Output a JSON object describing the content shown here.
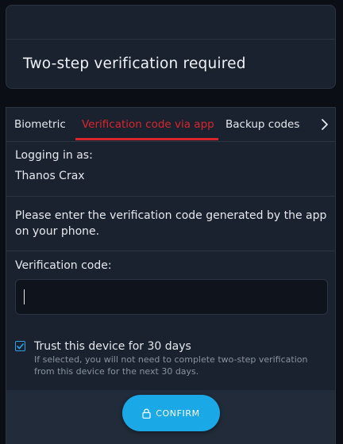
{
  "header": {
    "title": "Two-step verification required"
  },
  "tabs": [
    {
      "label": "Biometric",
      "active": false
    },
    {
      "label": "Verification code via app",
      "active": true
    },
    {
      "label": "Backup codes",
      "active": false
    }
  ],
  "tabs_more_icon": "chevron-right-icon",
  "login": {
    "label": "Logging in as:",
    "user": "Thanos Crax"
  },
  "instructions": "Please enter the verification code generated by the app on your phone.",
  "code_field": {
    "label": "Verification code:",
    "value": "",
    "placeholder": ""
  },
  "trust": {
    "checked": true,
    "label": "Trust this device for 30 days",
    "help": "If selected, you will not need to complete two-step verification from this device for the next 30 days."
  },
  "confirm": {
    "label": "CONFIRM",
    "icon": "lock-icon"
  },
  "colors": {
    "accent_red": "#d9262c",
    "accent_blue": "#1ba8e6",
    "panel_bg": "#1a2230",
    "page_bg": "#0b0f15"
  }
}
